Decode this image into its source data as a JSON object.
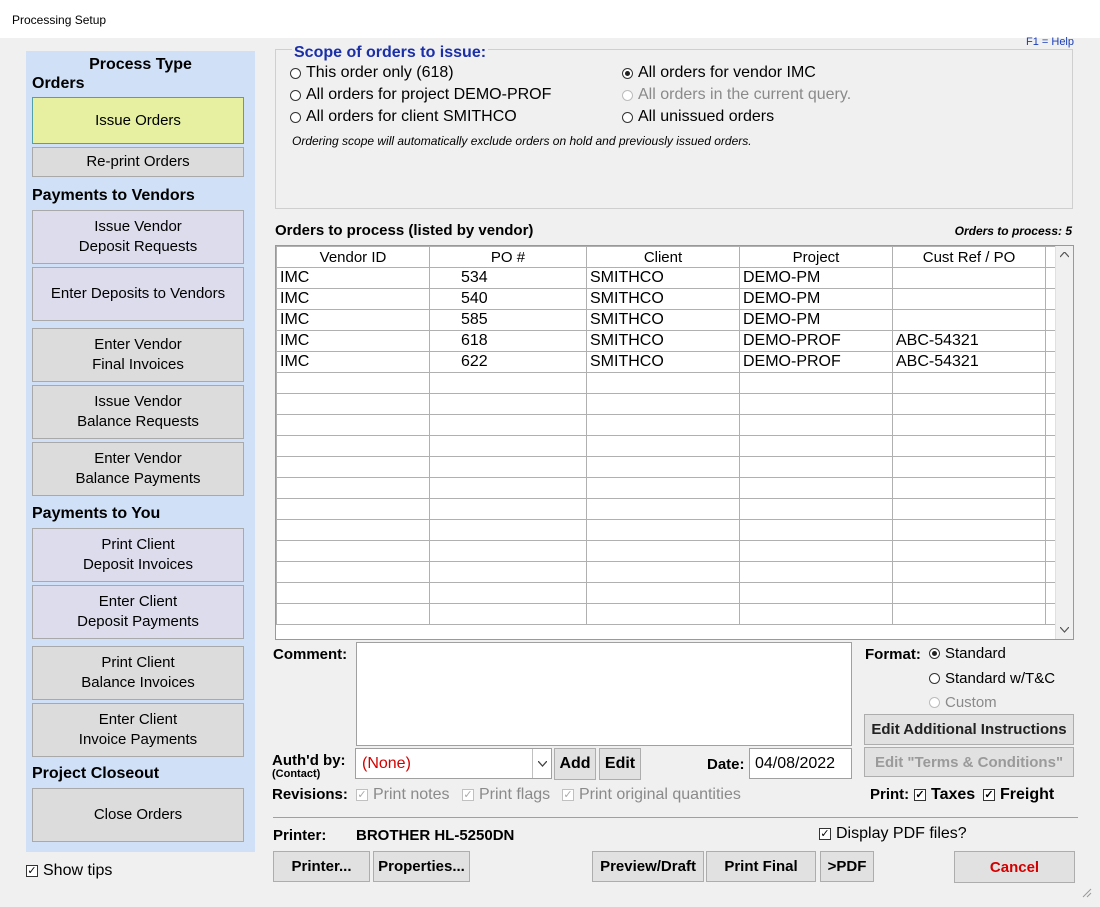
{
  "window": {
    "title": "Processing Setup",
    "help": "F1 = Help"
  },
  "left": {
    "title": "Process Type",
    "sections": {
      "orders": "Orders",
      "payments_vendors": "Payments to Vendors",
      "payments_you": "Payments to You",
      "closeout": "Project Closeout"
    },
    "buttons": {
      "issue_orders": "Issue Orders",
      "reprint_orders": "Re-print Orders",
      "issue_vendor_deposit": "Issue Vendor\nDeposit Requests",
      "enter_deposits_vendors": "Enter Deposits to Vendors",
      "enter_vendor_final": "Enter Vendor\nFinal Invoices",
      "issue_vendor_balance": "Issue Vendor\nBalance Requests",
      "enter_vendor_balance": "Enter Vendor\nBalance Payments",
      "print_client_deposit": "Print Client\nDeposit Invoices",
      "enter_client_deposit": "Enter Client\nDeposit Payments",
      "print_client_balance": "Print Client\nBalance Invoices",
      "enter_client_invoice": "Enter Client\nInvoice Payments",
      "close_orders": "Close Orders"
    },
    "show_tips": "Show tips"
  },
  "scope": {
    "title": "Scope of orders to issue:",
    "options": {
      "this_order": "This order only (618)",
      "project": "All orders for project DEMO-PROF",
      "client": "All orders for client SMITHCO",
      "vendor": "All orders for vendor IMC",
      "query": "All orders in the current query.",
      "unissued": "All unissued orders"
    },
    "selected": "vendor",
    "note": "Ordering scope will automatically exclude orders on hold and previously issued orders."
  },
  "grid": {
    "title": "Orders to process (listed by vendor)",
    "count": "Orders to process: 5",
    "columns": [
      "Vendor ID",
      "PO #",
      "Client",
      "Project",
      "Cust Ref / PO"
    ],
    "rows": [
      [
        "IMC",
        "534",
        "SMITHCO",
        "DEMO-PM",
        ""
      ],
      [
        "IMC",
        "540",
        "SMITHCO",
        "DEMO-PM",
        ""
      ],
      [
        "IMC",
        "585",
        "SMITHCO",
        "DEMO-PM",
        ""
      ],
      [
        "IMC",
        "618",
        "SMITHCO",
        "DEMO-PROF",
        "ABC-54321"
      ],
      [
        "IMC",
        "622",
        "SMITHCO",
        "DEMO-PROF",
        "ABC-54321"
      ]
    ],
    "empty_rows": 12
  },
  "comment": {
    "label": "Comment:",
    "value": ""
  },
  "format": {
    "label": "Format:",
    "standard": "Standard",
    "standard_tc": "Standard w/T&C",
    "custom": "Custom",
    "selected": "standard"
  },
  "auth": {
    "label": "Auth'd by:",
    "sublabel": "(Contact)",
    "value": "(None)",
    "add": "Add",
    "edit": "Edit"
  },
  "date": {
    "label": "Date:",
    "value": "04/08/2022"
  },
  "buttons": {
    "edit_instructions": "Edit Additional Instructions",
    "edit_terms": "Edit \"Terms & Conditions\""
  },
  "revisions": {
    "label": "Revisions:",
    "notes": "Print notes",
    "flags": "Print flags",
    "quantities": "Print original quantities"
  },
  "print_opts": {
    "label": "Print:",
    "taxes": "Taxes",
    "freight": "Freight"
  },
  "printer": {
    "label": "Printer:",
    "value": "BROTHER HL-5250DN",
    "display_pdf": "Display PDF files?"
  },
  "bottom": {
    "printer_btn": "Printer...",
    "properties_btn": "Properties...",
    "preview": "Preview/Draft",
    "print_final": "Print Final",
    "pdf": ">PDF",
    "cancel": "Cancel"
  },
  "colors": {
    "accent": "#1a2fa8",
    "cancel": "#d40000",
    "active": "#e6f0a0",
    "panel": "#cfe0f7"
  }
}
